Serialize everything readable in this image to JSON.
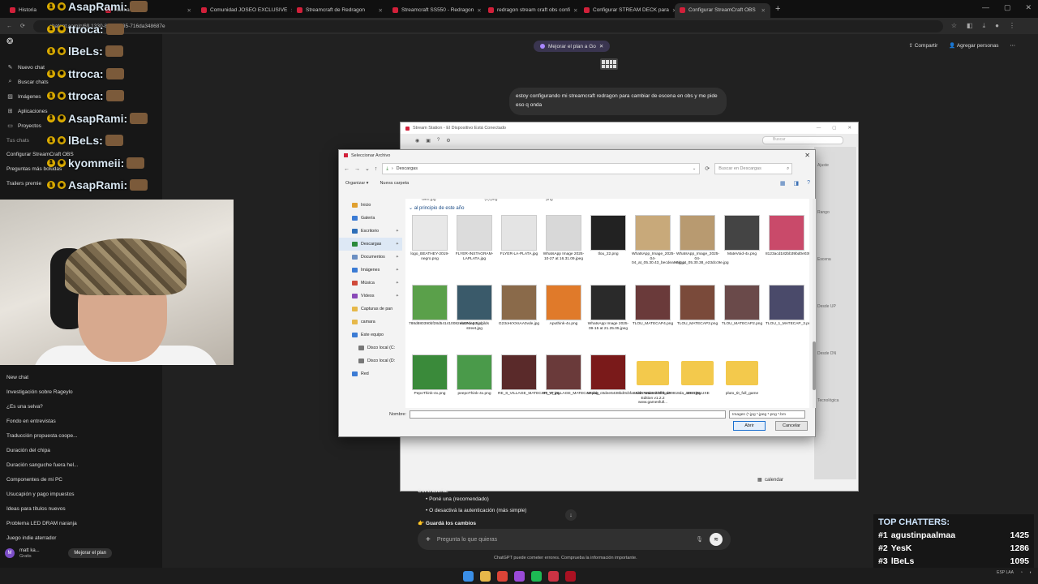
{
  "browser": {
    "tabs": [
      {
        "label": "Historia",
        "active": false
      },
      {
        "label": "Racha d",
        "active": false
      },
      {
        "label": "Comunidad JOSEO EXCLUSIVE",
        "active": false
      },
      {
        "label": "Streamcraft de Redragon",
        "active": false
      },
      {
        "label": "Streamcraft SS550 - Redragon",
        "active": false
      },
      {
        "label": "redragon stream craft obs confi",
        "active": false
      },
      {
        "label": "Configurar STREAM DECK para",
        "active": false
      },
      {
        "label": "Configurar StreamCraft OBS",
        "active": true
      }
    ],
    "url": "chatgpt.com/c/69  1330-8326-bf35-716da348687e"
  },
  "sidebar": {
    "items": [
      {
        "icon": "new-chat-icon",
        "label": "Nuevo chat"
      },
      {
        "icon": "search-icon",
        "label": "Buscar chats"
      },
      {
        "icon": "image-icon",
        "label": "Imágenes"
      },
      {
        "icon": "apps-icon",
        "label": "Aplicaciones"
      },
      {
        "icon": "folder-icon",
        "label": "Proyectos"
      }
    ],
    "chats_heading": "Tus chats",
    "chats_top": [
      "Configurar StreamCraft OBS",
      "Preguntas más boludas",
      "Trailers premie"
    ],
    "chats_bottom": [
      "New chat",
      "Investigación sobre Rageylo",
      "¿Es una selva?",
      "Fondo en entrevistas",
      "Traducción propuesta coope...",
      "Duración del chipa",
      "Duración sanguche fuera hel...",
      "Componentes de mi PC",
      "Usucapión y pago impuestos",
      "Ideas para títulos nuevos",
      "Problema LED DRAM naranja",
      "Juego indie aterrador"
    ],
    "user": {
      "initials": "M",
      "name": "matt ka...",
      "plan": "Gratis",
      "upgrade": "Mejorar el plan"
    }
  },
  "stream_chat": [
    {
      "user": "AsapRami:"
    },
    {
      "user": "ttroca:"
    },
    {
      "user": "lBeLs:"
    },
    {
      "user": "ttroca:"
    },
    {
      "user": "ttroca:"
    },
    {
      "user": "AsapRami:"
    },
    {
      "user": "lBeLs:"
    },
    {
      "user": "kyommeii:"
    },
    {
      "user": "AsapRami:"
    }
  ],
  "chatgpt": {
    "upgrade_pill": "Mejorar el plan a Go",
    "share": "Compartir",
    "add_people": "Agregar personas",
    "user_message": "estoy configurando mi streamcraft redragon para cambiar de escena en obs y me pide eso q onda",
    "answer_label": "Contraseña:",
    "bullets": [
      "Poné una (recomendado)",
      "O desactivá la autenticación (más simple)"
    ],
    "save_line": "Guardá los cambios",
    "input_placeholder": "Pregunta lo que quieras",
    "disclaimer": "ChatGPT puede cometer errores. Comprueba la información importante."
  },
  "stream_station": {
    "title": "Stream Station - El Dispositivo Está Conectado",
    "search": "Buscar",
    "right_labels": [
      "Ajuste",
      "Rango",
      "Escena",
      "Desde UP",
      "Desde DN",
      "Tecnológica"
    ],
    "calendar": "calendar"
  },
  "file_dialog": {
    "title": "Seleccionar Archivo",
    "path": "Descargas",
    "search_placeholder": "Buscar en Descargas",
    "organize": "Organizar",
    "new_folder": "Nueva carpeta",
    "nav": [
      {
        "label": "Inicio",
        "color": "#e0a030",
        "indent": false,
        "pin": false
      },
      {
        "label": "Galería",
        "color": "#3b7bd4",
        "indent": false,
        "pin": false
      },
      {
        "label": "Escritorio",
        "color": "#2f6fb8",
        "indent": false,
        "pin": true
      },
      {
        "label": "Descargas",
        "color": "#2a8a3a",
        "indent": false,
        "pin": true
      },
      {
        "label": "Documentos",
        "color": "#6b8fc2",
        "indent": false,
        "pin": true
      },
      {
        "label": "Imágenes",
        "color": "#3b7bd4",
        "indent": false,
        "pin": true
      },
      {
        "label": "Música",
        "color": "#d04a3a",
        "indent": false,
        "pin": true
      },
      {
        "label": "Vídeos",
        "color": "#8a4ab8",
        "indent": false,
        "pin": true
      },
      {
        "label": "Capturas de pan",
        "color": "#e6b84a",
        "indent": false,
        "pin": false
      },
      {
        "label": "camara",
        "color": "#e6b84a",
        "indent": false,
        "pin": false
      },
      {
        "label": "Este equipo",
        "color": "#3b7bd4",
        "indent": false,
        "pin": false
      },
      {
        "label": "Disco local (C:",
        "color": "#777777",
        "indent": true,
        "pin": false
      },
      {
        "label": "Disco local (D:",
        "color": "#777777",
        "indent": true,
        "pin": false
      },
      {
        "label": "Red",
        "color": "#3b7bd4",
        "indent": false,
        "pin": false
      }
    ],
    "top_strip": [
      "Gen.jpg",
      "(1).png",
      "png"
    ],
    "group": "al principio de este año",
    "files": [
      {
        "name": "logo_BEATHEY-2019-negro.png",
        "type": "image",
        "color": "#e8e8e8"
      },
      {
        "name": "FLYER-INSTAGRAM-LAPLATA.jpg",
        "type": "image",
        "color": "#dcdcdc"
      },
      {
        "name": "FLYER-LA-PLATA.jpg",
        "type": "image",
        "color": "#e4e4e4"
      },
      {
        "name": "WhatsApp Image 2025-10-27 at 16.31.09.jpeg",
        "type": "image",
        "color": "#d8d8d8"
      },
      {
        "name": "tlou_22.png",
        "type": "image",
        "color": "#222222"
      },
      {
        "name": "WhatsApp_Image_2025-04-04_at_05.30.43_becdea9e.jpg",
        "type": "image",
        "color": "#c8a97a"
      },
      {
        "name": "WhatsApp_Image_2025-04-04_at_05.30.38_e23dcc9e.jpg",
        "type": "image",
        "color": "#b89a70"
      },
      {
        "name": "MateVoid-4x.png",
        "type": "image",
        "color": "#444444"
      },
      {
        "name": "8123acd182bb39bd0e030977de3b1368.jpg",
        "type": "image",
        "color": "#c94a6a"
      },
      {
        "name": "788d880390bf28d541410082eb07de12.jpg",
        "type": "image",
        "color": "#5aa04a"
      },
      {
        "name": "matecap 9 childs street.jpg",
        "type": "image",
        "color": "#3a5a6a"
      },
      {
        "name": "G23oHrXXsAA0vde.jpg",
        "type": "image",
        "color": "#8a6a4a"
      },
      {
        "name": "Aputhink-4x.png",
        "type": "image",
        "color": "#e07a2a"
      },
      {
        "name": "WhatsApp Image 2025-09-15 at 21.25.05.jpeg",
        "type": "image",
        "color": "#2a2a2a"
      },
      {
        "name": "TLOU_MATECAP4.png",
        "type": "image",
        "color": "#6a3a3a"
      },
      {
        "name": "TLOU_MATECAP3.png",
        "type": "image",
        "color": "#7a4a3a"
      },
      {
        "name": "TLOU_MATECAP2.png",
        "type": "image",
        "color": "#6a4a4a"
      },
      {
        "name": "TLOU_1_MATECAP_3.png",
        "type": "image",
        "color": "#4a4a6a"
      },
      {
        "name": "PepoThink-4x.png",
        "type": "image",
        "color": "#3a8a3a"
      },
      {
        "name": "peepoThink-4x.png",
        "type": "image",
        "color": "#4a9a4a"
      },
      {
        "name": "RE_8_VILLAGE_MATECAP_YT.jpg",
        "type": "image",
        "color": "#5a2a2a"
      },
      {
        "name": "RE_8_VILLAGE_MATECAP.png",
        "type": "image",
        "color": "#6a3a3a"
      },
      {
        "name": "tumblr_c8dee6438bd0cbfa853f8704c03bbff9_d99818da_1280.jpg",
        "type": "image",
        "color": "#7a1a1a"
      },
      {
        "name": "Alan Wake 2 Deluxe Edition v1.2.2 www.gamesfull...",
        "type": "folder",
        "color": "#f3c94c"
      },
      {
        "name": "JEC DELUXE",
        "type": "folder",
        "color": "#f3c94c"
      },
      {
        "name": "pluto_tit_full_game",
        "type": "folder",
        "color": "#f3c94c"
      }
    ],
    "name_label": "Nombre:",
    "name_value": "",
    "type_filter": "Imagen (*.jpg *.jpeg *.png *.bm",
    "open": "Abrir",
    "cancel": "Cancelar"
  },
  "top_chatters": {
    "title": "TOP CHATTERS:",
    "rows": [
      {
        "rank": "#1",
        "name": "agustinpaalmaa",
        "count": "1425"
      },
      {
        "rank": "#2",
        "name": "YesK",
        "count": "1286"
      },
      {
        "rank": "#3",
        "name": "lBeLs",
        "count": "1095"
      }
    ]
  },
  "taskbar": {
    "icons": [
      {
        "name": "windows-start-icon",
        "color": "#3a8ee6"
      },
      {
        "name": "file-explorer-icon",
        "color": "#e6b84a"
      },
      {
        "name": "chrome-icon",
        "color": "#db4437"
      },
      {
        "name": "obs-icon",
        "color": "#9a4ad8"
      },
      {
        "name": "spotify-icon",
        "color": "#1db954"
      },
      {
        "name": "app-icon",
        "color": "#cc3344"
      },
      {
        "name": "streamcraft-icon",
        "color": "#aa1122"
      }
    ],
    "lang": "ESP LAA"
  }
}
